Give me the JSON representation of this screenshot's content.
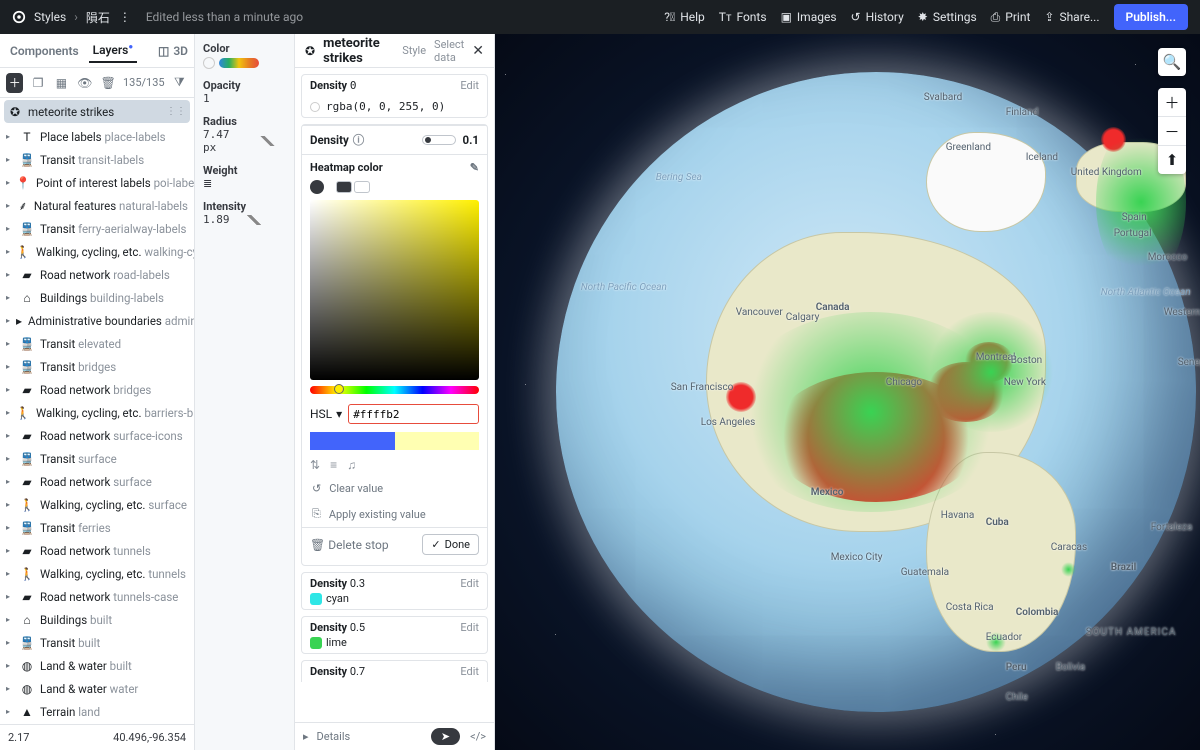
{
  "topbar": {
    "breadcrumb1": "Styles",
    "breadcrumb2": "隕石",
    "edited": "Edited less than a minute ago",
    "help": "Help",
    "fonts": "Fonts",
    "images": "Images",
    "history": "History",
    "settings": "Settings",
    "print": "Print",
    "share": "Share...",
    "publish": "Publish..."
  },
  "leftTabs": {
    "components": "Components",
    "layers": "Layers",
    "threeD": "3D",
    "count": "135/135"
  },
  "layerSelected": "meteorite strikes",
  "layers": [
    {
      "icon": "T",
      "name": "Place labels",
      "sub": "place-labels"
    },
    {
      "icon": "train",
      "name": "Transit",
      "sub": "transit-labels"
    },
    {
      "icon": "pin",
      "name": "Point of interest labels",
      "sub": "poi-labels"
    },
    {
      "icon": "leaf",
      "name": "Natural features",
      "sub": "natural-labels"
    },
    {
      "icon": "train",
      "name": "Transit",
      "sub": "ferry-aerialway-labels"
    },
    {
      "icon": "walk",
      "name": "Walking, cycling, etc.",
      "sub": "walking-cycling-l"
    },
    {
      "icon": "road",
      "name": "Road network",
      "sub": "road-labels"
    },
    {
      "icon": "bldg",
      "name": "Buildings",
      "sub": "building-labels"
    },
    {
      "icon": "flag",
      "name": "Administrative boundaries",
      "sub": "admin"
    },
    {
      "icon": "train",
      "name": "Transit",
      "sub": "elevated"
    },
    {
      "icon": "train",
      "name": "Transit",
      "sub": "bridges"
    },
    {
      "icon": "road",
      "name": "Road network",
      "sub": "bridges"
    },
    {
      "icon": "walk",
      "name": "Walking, cycling, etc.",
      "sub": "barriers-bridges"
    },
    {
      "icon": "road",
      "name": "Road network",
      "sub": "surface-icons"
    },
    {
      "icon": "train",
      "name": "Transit",
      "sub": "surface"
    },
    {
      "icon": "road",
      "name": "Road network",
      "sub": "surface"
    },
    {
      "icon": "walk",
      "name": "Walking, cycling, etc.",
      "sub": "surface"
    },
    {
      "icon": "train",
      "name": "Transit",
      "sub": "ferries"
    },
    {
      "icon": "road",
      "name": "Road network",
      "sub": "tunnels"
    },
    {
      "icon": "walk",
      "name": "Walking, cycling, etc.",
      "sub": "tunnels"
    },
    {
      "icon": "road",
      "name": "Road network",
      "sub": "tunnels-case"
    },
    {
      "icon": "bldg",
      "name": "Buildings",
      "sub": "built"
    },
    {
      "icon": "train",
      "name": "Transit",
      "sub": "built"
    },
    {
      "icon": "globe",
      "name": "Land & water",
      "sub": "built"
    },
    {
      "icon": "globe",
      "name": "Land & water",
      "sub": "water"
    },
    {
      "icon": "terr",
      "name": "Terrain",
      "sub": "land"
    }
  ],
  "footer": {
    "zoom": "2.17",
    "coords": "40.496,-96.354"
  },
  "props": {
    "color": "Color",
    "opacity": "Opacity",
    "opacityVal": "1",
    "radius": "Radius",
    "radiusVal": "7.47 px",
    "weight": "Weight",
    "intensity": "Intensity",
    "intensityVal": "1.89"
  },
  "panel2": {
    "title": "meteorite strikes",
    "styleTab": "Style",
    "selectTab": "Select data",
    "densityCard": {
      "label": "Density",
      "val": "0",
      "edit": "Edit",
      "rgba": "rgba(0, 0, 255, 0)"
    },
    "densityHead": "Density",
    "densitySlider": "0.1",
    "heatmap": "Heatmap color",
    "hsl": "HSL",
    "hex": "#ffffb2",
    "clear": "Clear value",
    "apply": "Apply existing value",
    "delete": "Delete stop",
    "done": "Done",
    "stop03": {
      "d": "Density",
      "v": "0.3",
      "c": "cyan",
      "hex": "#2ee6e6"
    },
    "stop05": {
      "d": "Density",
      "v": "0.5",
      "c": "lime",
      "hex": "#39d353"
    },
    "stop07": {
      "d": "Density",
      "v": "0.7"
    },
    "edit": "Edit",
    "details": "Details"
  },
  "mapLabels": {
    "beringSea": "Bering Sea",
    "greenland": "Greenland",
    "svalbard": "Svalbard",
    "finland": "Finland",
    "iceland": "Iceland",
    "uk": "United Kingdom",
    "spain": "Spain",
    "portugal": "Portugal",
    "morocco": "Morocco",
    "westernSahara": "Western Sahara",
    "senegal": "Senegal",
    "canada": "Canada",
    "vancouver": "Vancouver",
    "calgary": "Calgary",
    "montreal": "Montreal",
    "boston": "Boston",
    "newyork": "New York",
    "sanfran": "San Francisco",
    "losangeles": "Los Angeles",
    "chicago": "Chicago",
    "mexico": "Mexico",
    "mexicocity": "Mexico City",
    "havana": "Havana",
    "cuba": "Cuba",
    "guatemala": "Guatemala",
    "costarica": "Costa Rica",
    "caracas": "Caracas",
    "fortaleza": "Fortaleza",
    "brazil": "Brazil",
    "southamerica": "SOUTH AMERICA",
    "colombia": "Colombia",
    "bolivia": "Bolivia",
    "ecuador": "Ecuador",
    "peru": "Peru",
    "chile": "Chile",
    "npac": "North Pacific Ocean",
    "natl": "North Atlantic Ocean"
  }
}
